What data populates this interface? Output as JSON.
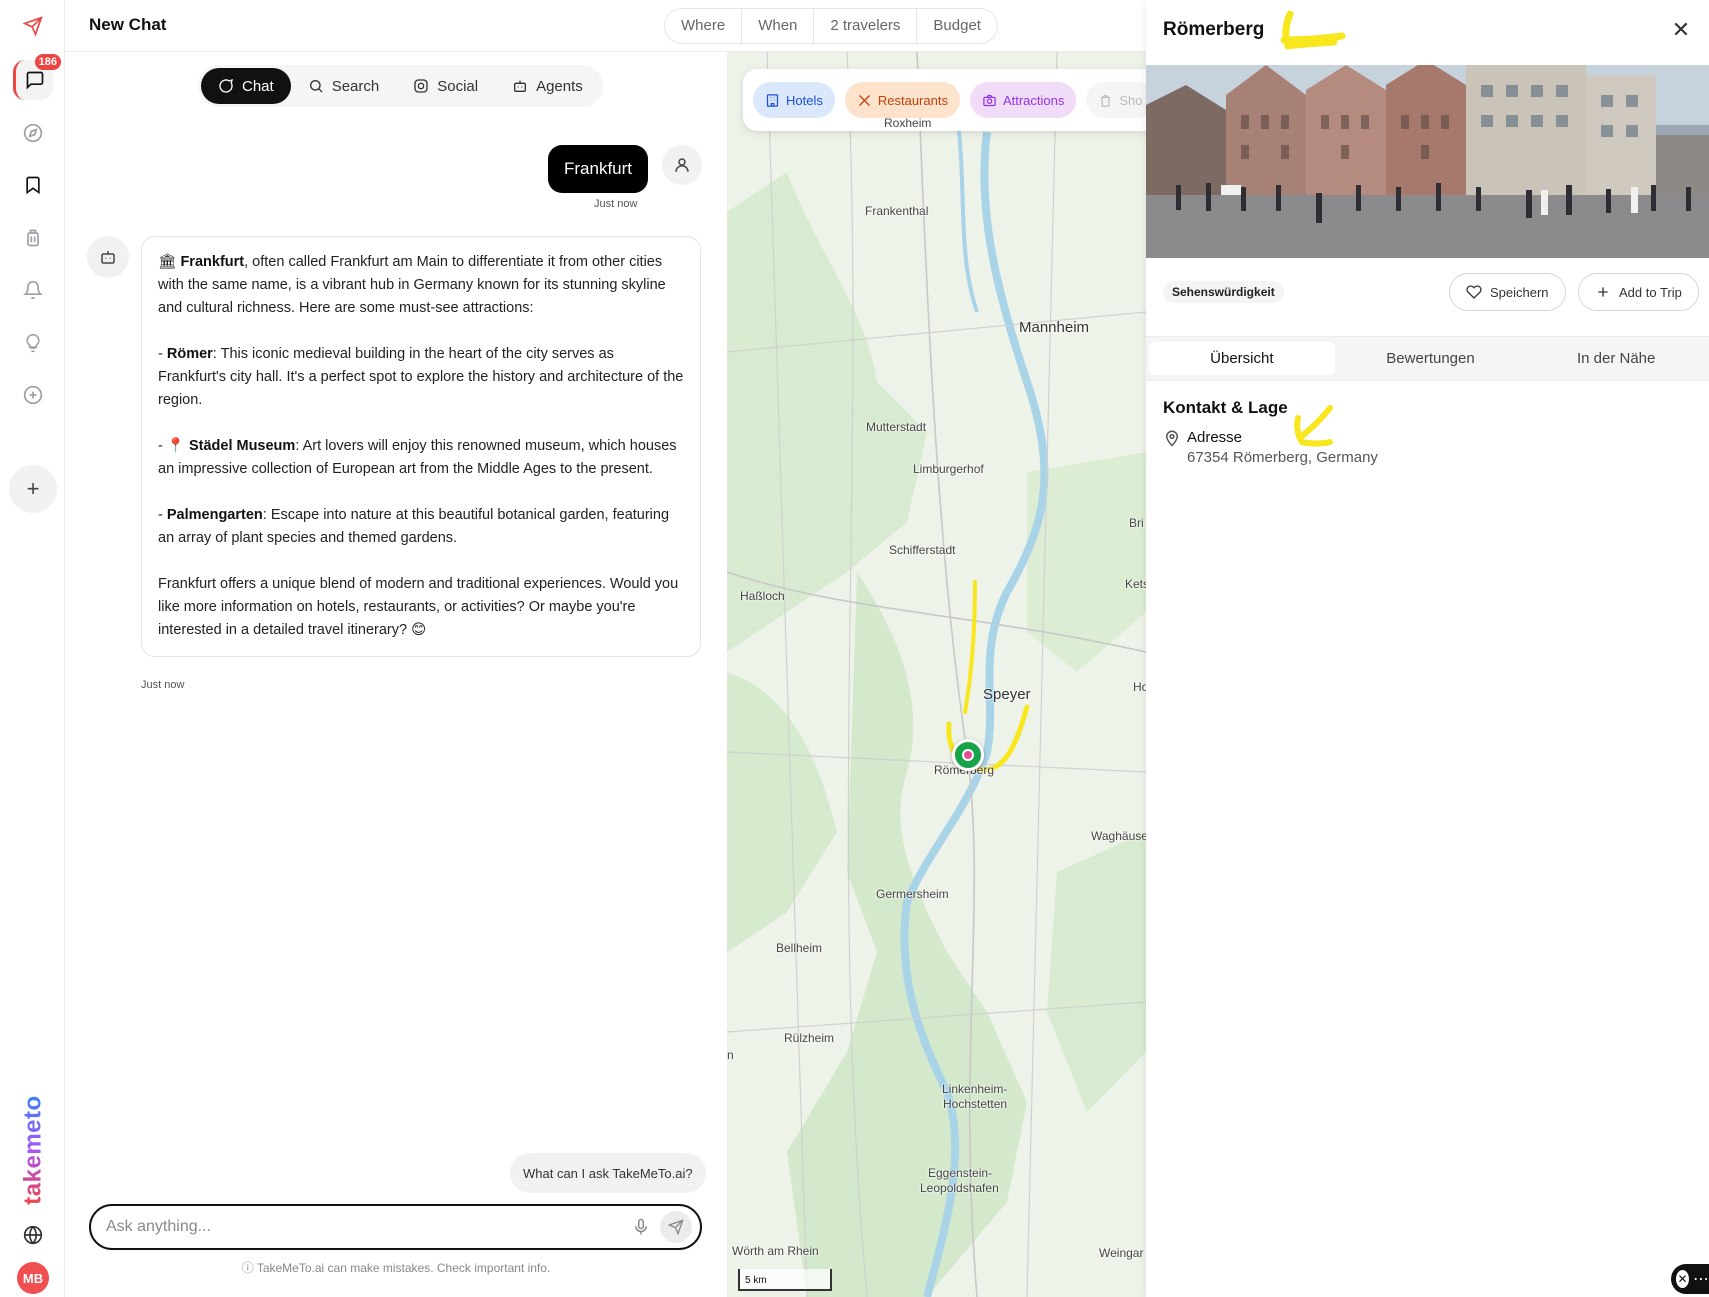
{
  "chat_header": {
    "title": "New Chat"
  },
  "trip_filters": [
    "Where",
    "When",
    "2 travelers",
    "Budget"
  ],
  "sidebar": {
    "badge_count": "186",
    "brand": "takemeto",
    "avatar_initials": "MB"
  },
  "modes": [
    {
      "label": "Chat",
      "icon": "chat-icon",
      "active": true
    },
    {
      "label": "Search",
      "icon": "search-icon",
      "active": false
    },
    {
      "label": "Social",
      "icon": "instagram-icon",
      "active": false
    },
    {
      "label": "Agents",
      "icon": "robot-icon",
      "active": false
    }
  ],
  "messages": {
    "user": {
      "text": "Frankfurt",
      "time": "Just now"
    },
    "bot": {
      "intro_bold": "Frankfurt",
      "intro_rest": ", often called Frankfurt am Main to differentiate it from other cities with the same name, is a vibrant hub in Germany known for its stunning skyline and cultural richness. Here are some must-see attractions:",
      "items": [
        {
          "prefix": "- ",
          "bold": "Römer",
          "text": ": This iconic medieval building in the heart of the city serves as Frankfurt's city hall. It's a perfect spot to explore the history and architecture of the region."
        },
        {
          "prefix": "- 📍 ",
          "bold": "Städel Museum",
          "text": ": Art lovers will enjoy this renowned museum, which houses an impressive collection of European art from the Middle Ages to the present."
        },
        {
          "prefix": "- ",
          "bold": "Palmengarten",
          "text": ": Escape into nature at this beautiful botanical garden, featuring an array of plant species and themed gardens."
        }
      ],
      "outro": "Frankfurt offers a unique blend of modern and traditional experiences. Would you like more information on hotels, restaurants, or activities? Or maybe you're interested in a detailed travel itinerary? 😊",
      "time": "Just now"
    }
  },
  "suggestion": "What can I ask TakeMeTo.ai?",
  "composer": {
    "placeholder": "Ask anything..."
  },
  "disclaimer": "ⓘ TakeMeTo.ai can make mistakes. Check important info.",
  "map": {
    "categories": [
      {
        "label": "Hotels",
        "icon": "building-icon"
      },
      {
        "label": "Restaurants",
        "icon": "utensils-icon"
      },
      {
        "label": "Attractions",
        "icon": "camera-icon"
      },
      {
        "label": "Sho",
        "icon": "shopping-bag-icon"
      }
    ],
    "places": {
      "roxheim": "Roxheim",
      "frankenthal": "Frankenthal",
      "mannheim": "Mannheim",
      "mutterstadt": "Mutterstadt",
      "limburgerhof": "Limburgerhof",
      "schifferstadt": "Schifferstadt",
      "hassloch": "Haßloch",
      "speyer": "Speyer",
      "roemerberg": "Römerberg",
      "waghaeusel": "Waghäusel",
      "germersheim": "Germersheim",
      "bellheim": "Bellheim",
      "ruelzheim": "Rülzheim",
      "linkenheim1": "Linkenheim-",
      "linkenheim2": "Hochstetten",
      "eggenstein1": "Eggenstein-",
      "eggenstein2": "Leopoldshafen",
      "woerth": "Wörth am Rhein",
      "weingarten": "Weingar",
      "br": "Bri",
      "kets": "Kets",
      "ho": "Ho",
      "n": "n"
    },
    "scale": "5 km"
  },
  "place_panel": {
    "title": "Römerberg",
    "category": "Sehenswürdigkeit",
    "save_label": "Speichern",
    "add_label": "Add to Trip",
    "tabs": [
      "Übersicht",
      "Bewertungen",
      "In der Nähe"
    ],
    "section_title": "Kontakt & Lage",
    "address_label": "Adresse",
    "address_value": "67354 Römerberg, Germany"
  },
  "colors": {
    "accent": "#ef4444",
    "active_tab": "#111111",
    "annotation": "#f8e71c",
    "marker": "#16a34a"
  }
}
